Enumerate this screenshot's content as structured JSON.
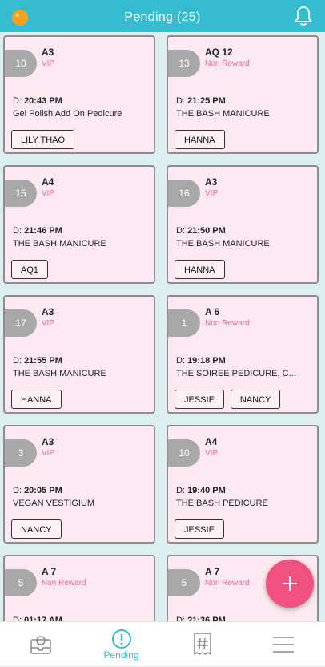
{
  "header": {
    "title": "Pending (25)",
    "colors": {
      "bar": "#36bcd0",
      "title": "#ffffff"
    },
    "logo_icon": "orange-logo-icon",
    "bell_icon": "bell-icon"
  },
  "cards": [
    {
      "number": "10",
      "room": "A3",
      "tier": "VIP",
      "time_label": "D:",
      "time": "20:43 PM",
      "service": "Gel Polish Add On Pedicure",
      "techs": [
        "LILY THAO"
      ]
    },
    {
      "number": "13",
      "room": "AQ 12",
      "tier": "Non Reward",
      "time_label": "D:",
      "time": "21:25 PM",
      "service": "THE BASH MANICURE",
      "techs": [
        "HANNA"
      ]
    },
    {
      "number": "15",
      "room": "A4",
      "tier": "VIP",
      "time_label": "D:",
      "time": "21:46 PM",
      "service": "THE BASH MANICURE",
      "techs": [
        "AQ1"
      ]
    },
    {
      "number": "16",
      "room": "A3",
      "tier": "VIP",
      "time_label": "D:",
      "time": "21:50 PM",
      "service": "THE BASH MANICURE",
      "techs": [
        "HANNA"
      ]
    },
    {
      "number": "17",
      "room": "A3",
      "tier": "VIP",
      "time_label": "D:",
      "time": "21:55 PM",
      "service": "THE BASH MANICURE",
      "techs": [
        "HANNA"
      ]
    },
    {
      "number": "1",
      "room": "A 6",
      "tier": "Non Reward",
      "time_label": "D:",
      "time": "19:18 PM",
      "service": "THE SOIREE PEDICURE, C...",
      "techs": [
        "JESSIE",
        "NANCY"
      ]
    },
    {
      "number": "3",
      "room": "A3",
      "tier": "VIP",
      "time_label": "D:",
      "time": "20:05 PM",
      "service": "VEGAN VESTIGIUM",
      "techs": [
        "NANCY"
      ]
    },
    {
      "number": "10",
      "room": "A4",
      "tier": "VIP",
      "time_label": "D:",
      "time": "19:40 PM",
      "service": "THE BASH PEDICURE",
      "techs": [
        "JESSIE"
      ]
    },
    {
      "number": "5",
      "room": "A 7",
      "tier": "Non Reward",
      "time_label": "D:",
      "time": "01:17 AM",
      "service": "",
      "techs": []
    },
    {
      "number": "5",
      "room": "A 7",
      "tier": "Non Reward",
      "time_label": "D:",
      "time": "21:36 PM",
      "service": "",
      "techs": []
    }
  ],
  "fab": {
    "icon": "plus-icon",
    "color": "#f0517e"
  },
  "bottom_nav": {
    "items": [
      {
        "icon": "profile-inbox-icon",
        "label": ""
      },
      {
        "icon": "alert-circle-icon",
        "label": "Pending",
        "active": true
      },
      {
        "icon": "ticket-number-icon",
        "label": ""
      },
      {
        "icon": "menu-icon",
        "label": ""
      }
    ],
    "active_color": "#37b9cf"
  }
}
